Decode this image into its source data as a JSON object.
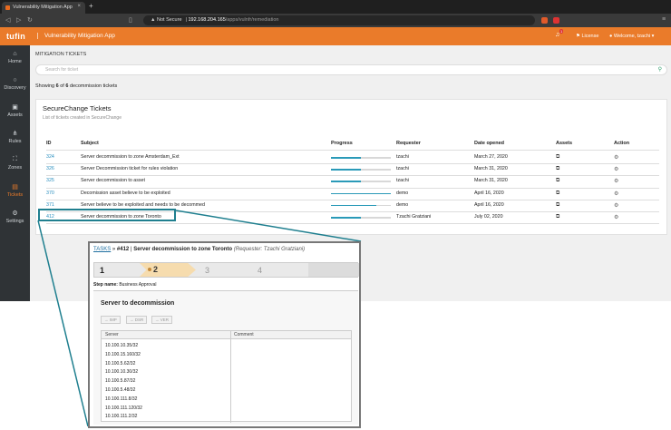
{
  "browser": {
    "tab_title": "Vulnerability Mitigation App",
    "tab_close": "×",
    "new_tab": "+",
    "security_label": "Not Secure",
    "url_host": "192.168.204.165",
    "url_path": "/apps/vulnfr/remediation"
  },
  "appbar": {
    "logo": "tufin",
    "title": "Vulnerability Mitigation App",
    "notification_count": "1",
    "license": "License",
    "welcome": "Welcome, tzachi"
  },
  "sidebar": {
    "items": [
      {
        "label": "Home",
        "icon": "home-icon"
      },
      {
        "label": "Discovery",
        "icon": "search-icon"
      },
      {
        "label": "Assets",
        "icon": "assets-icon"
      },
      {
        "label": "Rules",
        "icon": "rules-icon"
      },
      {
        "label": "Zones",
        "icon": "zones-icon"
      },
      {
        "label": "Tickets",
        "icon": "tickets-icon"
      },
      {
        "label": "Settings",
        "icon": "gear-icon"
      }
    ],
    "active": "Tickets"
  },
  "main": {
    "heading": "MITIGATION TICKETS",
    "search_placeholder": "Search for ticket",
    "showing": "Showing 6 of 6 decommission tickets",
    "card_title": "SecureChange Tickets",
    "card_subtitle": "List of tickets created in SecureChange",
    "columns": [
      "ID",
      "Subject",
      "Progress",
      "Requester",
      "Date opened",
      "Assets",
      "Action"
    ],
    "rows": [
      {
        "id": "324",
        "subject": "Server decommission to zone Amsterdam_Ext",
        "progress": 0.5,
        "requester": "tzachi",
        "date": "March 27, 2020"
      },
      {
        "id": "326",
        "subject": "Server Decommission ticket for rules violation",
        "progress": 0.5,
        "requester": "tzachi",
        "date": "March 31, 2020"
      },
      {
        "id": "325",
        "subject": "Server decommission to asset",
        "progress": 0.5,
        "requester": "tzachi",
        "date": "March 31, 2020"
      },
      {
        "id": "370",
        "subject": "Decomission asset believe to be exploited",
        "progress": 1.0,
        "requester": "demo",
        "date": "April 16, 2020"
      },
      {
        "id": "371",
        "subject": "Server believe to be exploited and needs to be decommed",
        "progress": 0.75,
        "requester": "demo",
        "date": "April 16, 2020"
      },
      {
        "id": "412",
        "subject": "Server decommission to zone Toronto",
        "progress": 0.5,
        "requester": "Tzachi Gratziani",
        "date": "July 02, 2020"
      }
    ]
  },
  "popup": {
    "tasks_link": "TASKS",
    "arrow": "»",
    "ticket": "#412",
    "separator": "|",
    "title": "Server decommission to zone Toronto",
    "requester": "(Requester: Tzachi Gratziani)",
    "steps": [
      "1",
      "2",
      "3",
      "4"
    ],
    "step_name_label": "Step name:",
    "step_name": "Business Approval",
    "section_title": "Server to decommission",
    "buttons": [
      "→ IMP",
      "→ DSR",
      "→ VER"
    ],
    "table_headers": [
      "Server",
      "Comment"
    ],
    "servers": [
      "10.100.10.35/32",
      "10.100.15.160/32",
      "10.100.5.62/32",
      "10.100.10.30/32",
      "10.100.5.87/32",
      "10.100.5.48/32",
      "10.100.111.8/32",
      "10.100.111.120/32",
      "10.100.111.2/32"
    ]
  },
  "colors": {
    "accent": "#ea7b2a",
    "sidebar": "#2f3336",
    "link": "#2a8fbf",
    "highlight": "#1f7f8f",
    "progress": "#2a9ab8"
  }
}
